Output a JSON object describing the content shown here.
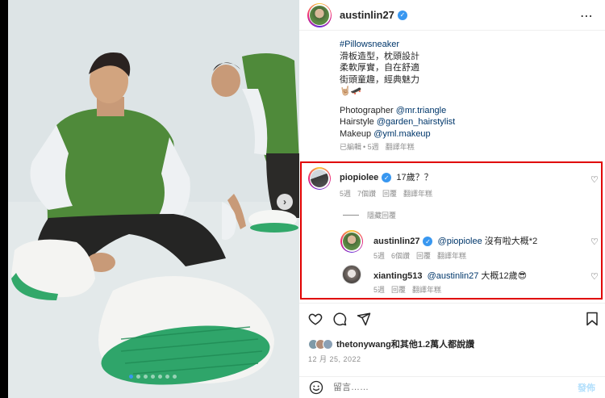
{
  "post": {
    "author": "austinlin27",
    "more_icon": "⋯",
    "caption": {
      "hashtag": "#Pillowsneaker",
      "line1": "滑板造型，枕頭設計",
      "line2": "柔軟厚實，自在舒適",
      "line3": "街頭童趣，經典魅力",
      "emoji_line": "🤘🏼🛹",
      "photographer_label": "Photographer ",
      "photographer_handle": "@mr.triangle",
      "hairstyle_label": "Hairstyle ",
      "hairstyle_handle": "@garden_hairstylist",
      "makeup_label": "Makeup ",
      "makeup_handle": "@yml.makeup",
      "edited": "已編輯",
      "time": "• 5週",
      "translate": "翻譯年糕"
    }
  },
  "comments": {
    "main": {
      "user": "piopiolee",
      "text": "17歲？？",
      "time": "5週",
      "likes": "7個讚",
      "reply": "回覆",
      "translate": "翻譯年糕"
    },
    "hide_replies": "隱藏回覆",
    "reply1": {
      "user": "austinlin27",
      "mention": "@piopiolee",
      "text": " 沒有啦大概*2",
      "time": "5週",
      "likes": "6個讚",
      "reply": "回覆",
      "translate": "翻譯年糕"
    },
    "reply2": {
      "user": "xianting513",
      "mention": "@austinlin27",
      "text": " 大概12歲😎",
      "time": "5週",
      "reply": "回覆",
      "translate": "翻譯年糕"
    }
  },
  "likes": {
    "text": "thetonywang和其他1.2萬人都說讚"
  },
  "date": "12 月 25, 2022",
  "comment_box": {
    "placeholder": "留言……",
    "post_label": "發佈"
  },
  "colors": {
    "verified": "#3897f0",
    "highlight_box": "#e00000",
    "link": "#00376b",
    "post_disabled": "#b2dffc"
  }
}
